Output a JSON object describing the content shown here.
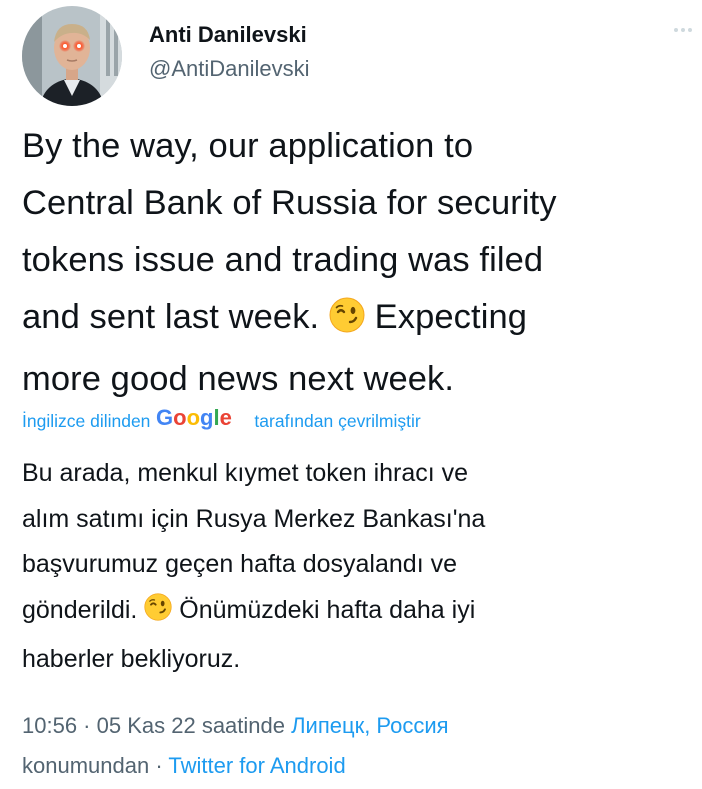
{
  "author": {
    "display_name": "Anti Danilevski",
    "handle": "@AntiDanilevski"
  },
  "tweet": {
    "text_before_emoji": "By the way, our application to\nCentral Bank of Russia for security\ntokens issue and trading was filed\nand sent last week. ",
    "text_after_emoji": " Expecting\nmore good news next week.",
    "emoji": "winking-face"
  },
  "translation": {
    "prefix": "İngilizce dilinden",
    "provider": "Google",
    "suffix": "tarafından çevrilmiştir",
    "text_before_emoji": "Bu arada, menkul kıymet token ihracı ve\nalım satımı için Rusya Merkez Bankası'na\nbaşvurumuz geçen hafta dosyalandı ve\ngönderildi. ",
    "text_after_emoji": " Önümüzdeki hafta daha iyi\nhaberler bekliyoruz."
  },
  "meta": {
    "time": "10:56",
    "separator": " · ",
    "date": "05 Kas 22",
    "date_suffix": " saatinde ",
    "location": "Липецк, Россия",
    "location_suffix": "konumundan",
    "source": "Twitter for Android"
  },
  "colors": {
    "link": "#1d9bf0",
    "secondary_text": "#536471",
    "primary_text": "#0f1419",
    "avatar_eyes": "#ff2a1a"
  },
  "icons": {
    "more": "more-dots-icon",
    "emoji": "winking-face-emoji"
  }
}
